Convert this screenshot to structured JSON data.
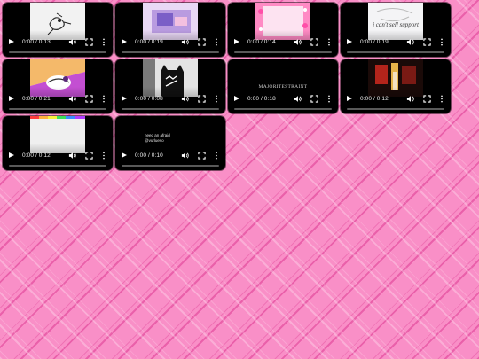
{
  "videos": [
    {
      "time": "0:00 / 0:13",
      "progress": 0
    },
    {
      "time": "0:00 / 0:19",
      "progress": 0
    },
    {
      "time": "0:00 / 0:14",
      "progress": 0
    },
    {
      "time": "0:00 / 0:19",
      "progress": 0,
      "caption": "i can't sell support"
    },
    {
      "time": "0:00 / 0:21",
      "progress": 0
    },
    {
      "time": "0:00 / 0:08",
      "progress": 0
    },
    {
      "time": "0:00 / 0:18",
      "progress": 0,
      "caption": "MAJORITESTRAINT"
    },
    {
      "time": "0:00 / 0:12",
      "progress": 0
    },
    {
      "time": "0:00 / 0:12",
      "progress": 0
    },
    {
      "time": "0:00 / 0:10",
      "progress": 0,
      "caption": "need an afraid\n@vurlueso"
    }
  ],
  "colors": {
    "background": "#f98fc7",
    "player": "#000000",
    "controls": "#ffffff"
  },
  "icons": [
    "play-icon",
    "volume-icon",
    "fullscreen-icon",
    "more-options-icon"
  ]
}
